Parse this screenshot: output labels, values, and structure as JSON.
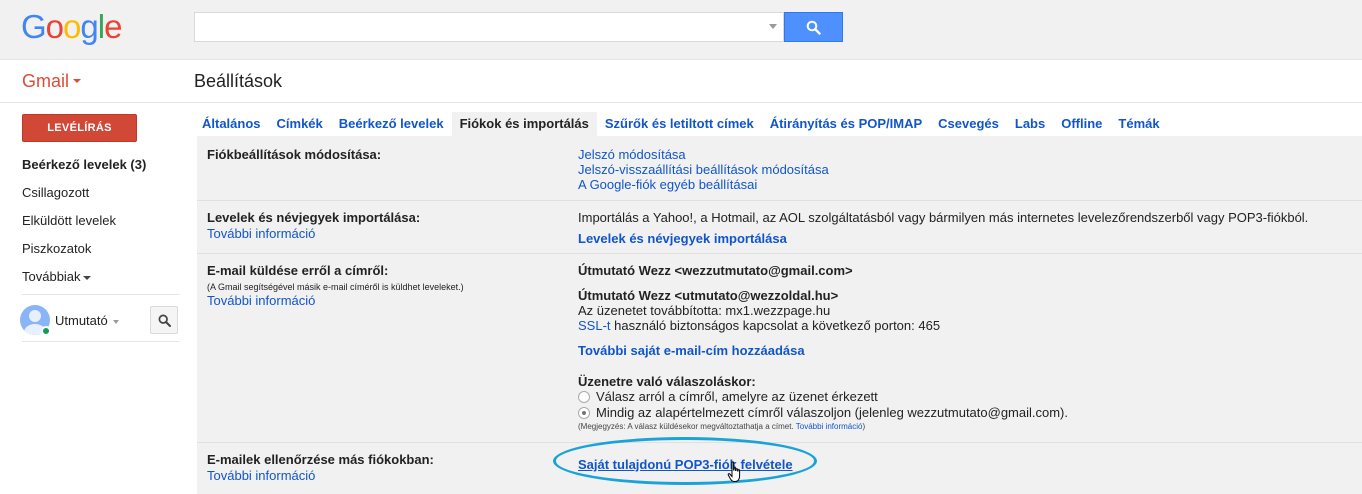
{
  "header": {
    "logo_letters": [
      {
        "ch": "G",
        "color": "#4285f4"
      },
      {
        "ch": "o",
        "color": "#ea4335"
      },
      {
        "ch": "o",
        "color": "#fbbc05"
      },
      {
        "ch": "g",
        "color": "#4285f4"
      },
      {
        "ch": "l",
        "color": "#34a853"
      },
      {
        "ch": "e",
        "color": "#ea4335"
      }
    ],
    "search_value": "",
    "search_icon": "search-icon"
  },
  "app": {
    "gmail_label": "Gmail",
    "page_title": "Beállítások"
  },
  "sidebar": {
    "compose_label": "LEVÉLÍRÁS",
    "items": [
      {
        "label": "Beérkező levelek (3)",
        "bold": true
      },
      {
        "label": "Csillagozott"
      },
      {
        "label": "Elküldött levelek"
      },
      {
        "label": "Piszkozatok"
      },
      {
        "label": "Továbbiak"
      }
    ],
    "chat_user": "Utmutató",
    "chat_search_icon": "search-icon"
  },
  "tabs": [
    {
      "label": "Általános"
    },
    {
      "label": "Címkék"
    },
    {
      "label": "Beérkező levelek"
    },
    {
      "label": "Fiókok és importálás",
      "active": true
    },
    {
      "label": "Szűrők és letiltott címek"
    },
    {
      "label": "Átirányítás és POP/IMAP"
    },
    {
      "label": "Csevegés"
    },
    {
      "label": "Labs"
    },
    {
      "label": "Offline"
    },
    {
      "label": "Témák"
    }
  ],
  "settings": {
    "account": {
      "label": "Fiókbeállítások módosítása:",
      "links": [
        "Jelszó módosítása",
        "Jelszó-visszaállítási beállítások módosítása",
        "A Google-fiók egyéb beállításai"
      ]
    },
    "import": {
      "label": "Levelek és névjegyek importálása:",
      "more": "További információ",
      "desc": "Importálás a Yahoo!, a Hotmail, az AOL szolgáltatásból vagy bármilyen más internetes levelezőrendszerből vagy POP3-fiókból.",
      "action": "Levelek és névjegyek importálása"
    },
    "send_as": {
      "label": "E-mail küldése erről a címről:",
      "note": "(A Gmail segítségével másik e-mail címéről is küldhet leveleket.)",
      "more": "További információ",
      "address1": "Útmutató Wezz <wezzutmutato@gmail.com>",
      "address2": "Útmutató Wezz <utmutato@wezzoldal.hu>",
      "forwarded": "Az üzenetet továbbította: mx1.wezzpage.hu",
      "ssl_link": "SSL-t",
      "ssl_text": " használó biztonságos kapcsolat a következő porton: 465",
      "add_link": "További saját e-mail-cím hozzáadása",
      "reply_heading": "Üzenetre való válaszoláskor:",
      "reply_opt1": "Válasz arról a címről, amelyre az üzenet érkezett",
      "reply_opt2": "Mindig az alapértelmezett címről válaszoljon (jelenleg wezzutmutato@gmail.com).",
      "tiny_note": "(Megjegyzés: A válasz küldésekor megváltoztathatja a címet.",
      "tiny_link": "További információ",
      "tiny_end": ")"
    },
    "check_mail": {
      "label": "E-mailek ellenőrzése más fiókokban:",
      "more": "További információ",
      "action": "Saját tulajdonú POP3-fiók felvétele"
    }
  }
}
